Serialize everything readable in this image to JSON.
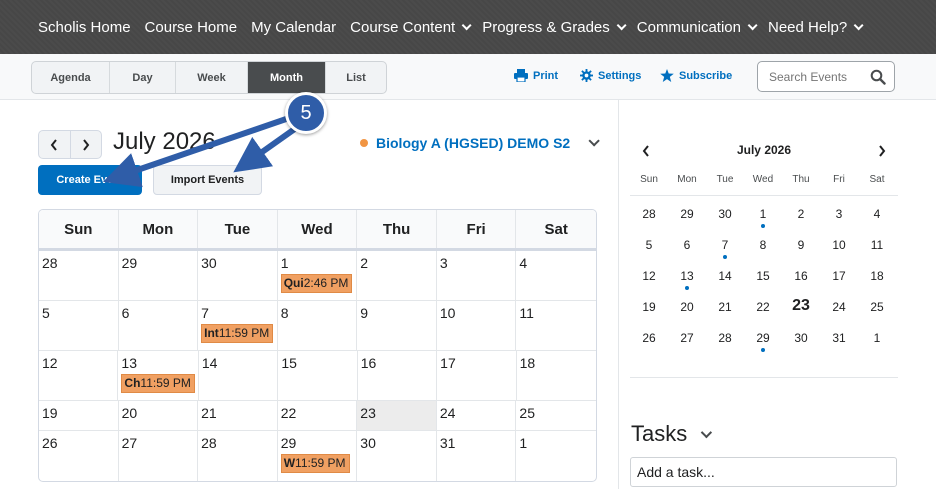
{
  "nav": {
    "items": [
      {
        "label": "Scholis Home",
        "dropdown": false
      },
      {
        "label": "Course Home",
        "dropdown": false
      },
      {
        "label": "My Calendar",
        "dropdown": false
      },
      {
        "label": "Course Content",
        "dropdown": true
      },
      {
        "label": "Progress & Grades",
        "dropdown": true
      },
      {
        "label": "Communication",
        "dropdown": true
      },
      {
        "label": "Need Help?",
        "dropdown": true
      }
    ]
  },
  "toolbar": {
    "view_tabs": [
      "Agenda",
      "Day",
      "Week",
      "Month",
      "List"
    ],
    "active_view": "Month",
    "print_label": "Print",
    "settings_label": "Settings",
    "subscribe_label": "Subscribe",
    "search_placeholder": "Search Events"
  },
  "calendar": {
    "month_title": "July 2026",
    "create_event_label": "Create Event",
    "import_events_label": "Import Events",
    "course_label": "Biology A (HGSED) DEMO S2",
    "course_color": "#f19543",
    "weekdays": [
      "Sun",
      "Mon",
      "Tue",
      "Wed",
      "Thu",
      "Fri",
      "Sat"
    ],
    "weeks": [
      [
        {
          "day": "28"
        },
        {
          "day": "29"
        },
        {
          "day": "30"
        },
        {
          "day": "1",
          "event": {
            "name": "Qui",
            "time": "2:46 PM"
          }
        },
        {
          "day": "2"
        },
        {
          "day": "3"
        },
        {
          "day": "4"
        }
      ],
      [
        {
          "day": "5"
        },
        {
          "day": "6"
        },
        {
          "day": "7",
          "event": {
            "name": "Int",
            "time": "11:59 PM"
          }
        },
        {
          "day": "8"
        },
        {
          "day": "9"
        },
        {
          "day": "10"
        },
        {
          "day": "11"
        }
      ],
      [
        {
          "day": "12"
        },
        {
          "day": "13",
          "event": {
            "name": "Ch",
            "time": "11:59 PM"
          }
        },
        {
          "day": "14"
        },
        {
          "day": "15"
        },
        {
          "day": "16"
        },
        {
          "day": "17"
        },
        {
          "day": "18"
        }
      ],
      [
        {
          "day": "19"
        },
        {
          "day": "20"
        },
        {
          "day": "21"
        },
        {
          "day": "22"
        },
        {
          "day": "23",
          "today": true
        },
        {
          "day": "24"
        },
        {
          "day": "25"
        }
      ],
      [
        {
          "day": "26"
        },
        {
          "day": "27"
        },
        {
          "day": "28"
        },
        {
          "day": "29",
          "event": {
            "name": "W",
            "time": "11:59 PM"
          }
        },
        {
          "day": "30"
        },
        {
          "day": "31"
        },
        {
          "day": "1"
        }
      ]
    ]
  },
  "mini_calendar": {
    "title": "July 2026",
    "weekdays": [
      "Sun",
      "Mon",
      "Tue",
      "Wed",
      "Thu",
      "Fri",
      "Sat"
    ],
    "days": [
      {
        "d": "28"
      },
      {
        "d": "29"
      },
      {
        "d": "30"
      },
      {
        "d": "1",
        "dot": true
      },
      {
        "d": "2"
      },
      {
        "d": "3"
      },
      {
        "d": "4"
      },
      {
        "d": "5"
      },
      {
        "d": "6"
      },
      {
        "d": "7",
        "dot": true
      },
      {
        "d": "8"
      },
      {
        "d": "9"
      },
      {
        "d": "10"
      },
      {
        "d": "11"
      },
      {
        "d": "12"
      },
      {
        "d": "13",
        "dot": true
      },
      {
        "d": "14"
      },
      {
        "d": "15"
      },
      {
        "d": "16"
      },
      {
        "d": "17"
      },
      {
        "d": "18"
      },
      {
        "d": "19"
      },
      {
        "d": "20"
      },
      {
        "d": "21"
      },
      {
        "d": "22"
      },
      {
        "d": "23",
        "today": true
      },
      {
        "d": "24"
      },
      {
        "d": "25"
      },
      {
        "d": "26"
      },
      {
        "d": "27"
      },
      {
        "d": "28"
      },
      {
        "d": "29",
        "dot": true
      },
      {
        "d": "30"
      },
      {
        "d": "31"
      },
      {
        "d": "1"
      }
    ]
  },
  "tasks": {
    "title": "Tasks",
    "input_value": "Add a task..."
  },
  "annotation": {
    "step_number": "5",
    "arrow_color": "#2f5da8"
  }
}
